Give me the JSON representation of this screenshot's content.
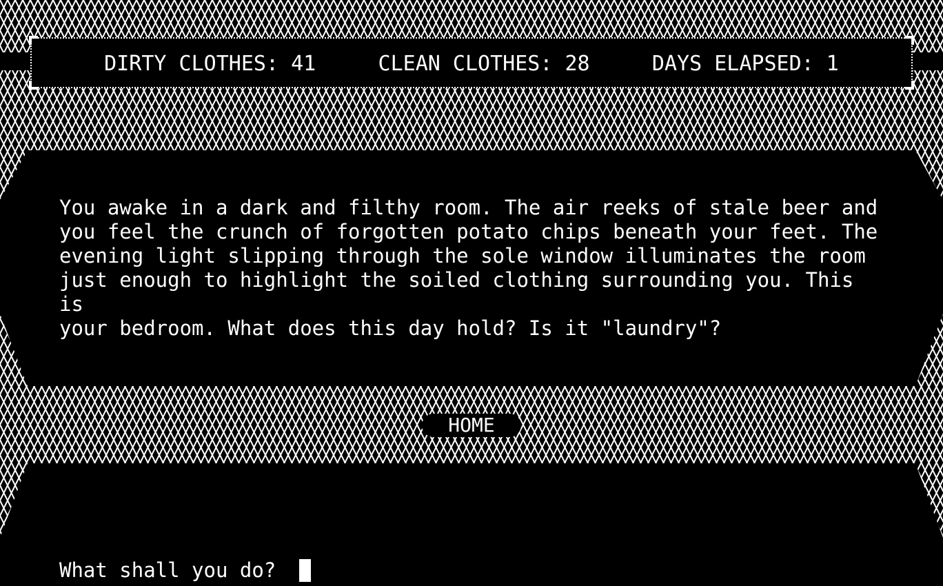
{
  "stats": {
    "dirty_label": "DIRTY CLOTHES:",
    "dirty_value": "41",
    "clean_label": "CLEAN CLOTHES:",
    "clean_value": "28",
    "days_label": "DAYS ELAPSED:",
    "days_value": "1"
  },
  "story": {
    "lines": [
      "You awake in a dark and filthy room. The air reeks of stale beer and",
      "you feel the crunch of forgotten potato chips beneath your feet. The",
      "evening light slipping through the sole window illuminates the room",
      "just enough to highlight the soiled clothing surrounding you. This is",
      "your bedroom. What does this day hold? Is it \"laundry\"?"
    ]
  },
  "location": {
    "label": "HOME"
  },
  "prompt": {
    "label": "What shall you do?",
    "value": ""
  },
  "colors": {
    "background": "#000000",
    "foreground": "#ffffff"
  }
}
